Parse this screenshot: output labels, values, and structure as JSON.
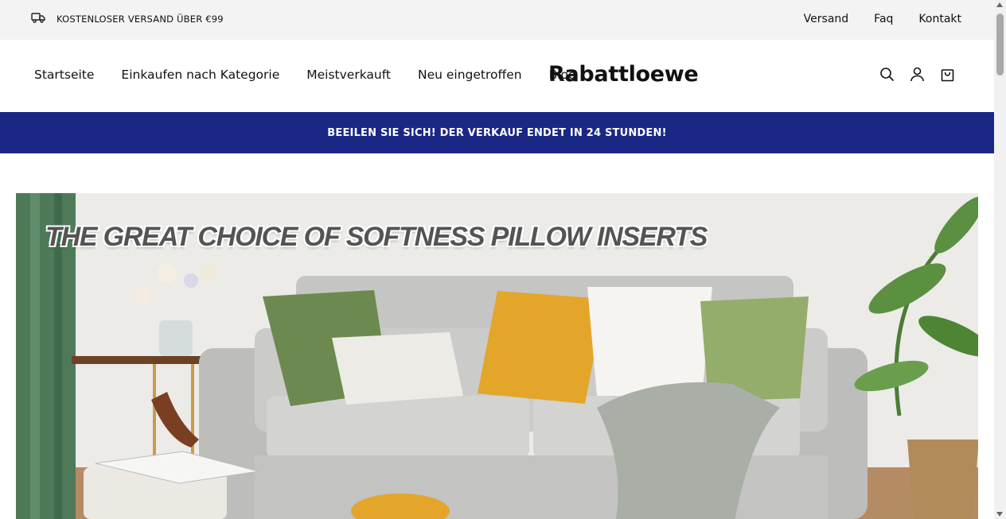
{
  "announcement": {
    "icon": "truck-icon",
    "text": "KOSTENLOSER VERSAND ÜBER €99"
  },
  "top_links": [
    "Versand",
    "Faq",
    "Kontakt"
  ],
  "nav": {
    "menu": [
      "Startseite",
      "Einkaufen nach Kategorie",
      "Meistverkauft",
      "Neu eingetroffen",
      "Blog"
    ],
    "logo": "Rabattloewe",
    "icons": [
      "search-icon",
      "account-icon",
      "cart-icon"
    ]
  },
  "promo_banner": {
    "text": "BEEILEN SIE SICH! DER VERKAUF ENDET IN 24 STUNDEN!",
    "bg": "#1a2785"
  },
  "hero": {
    "title": "THE GREAT CHOICE OF SOFTNESS PILLOW INSERTS"
  }
}
